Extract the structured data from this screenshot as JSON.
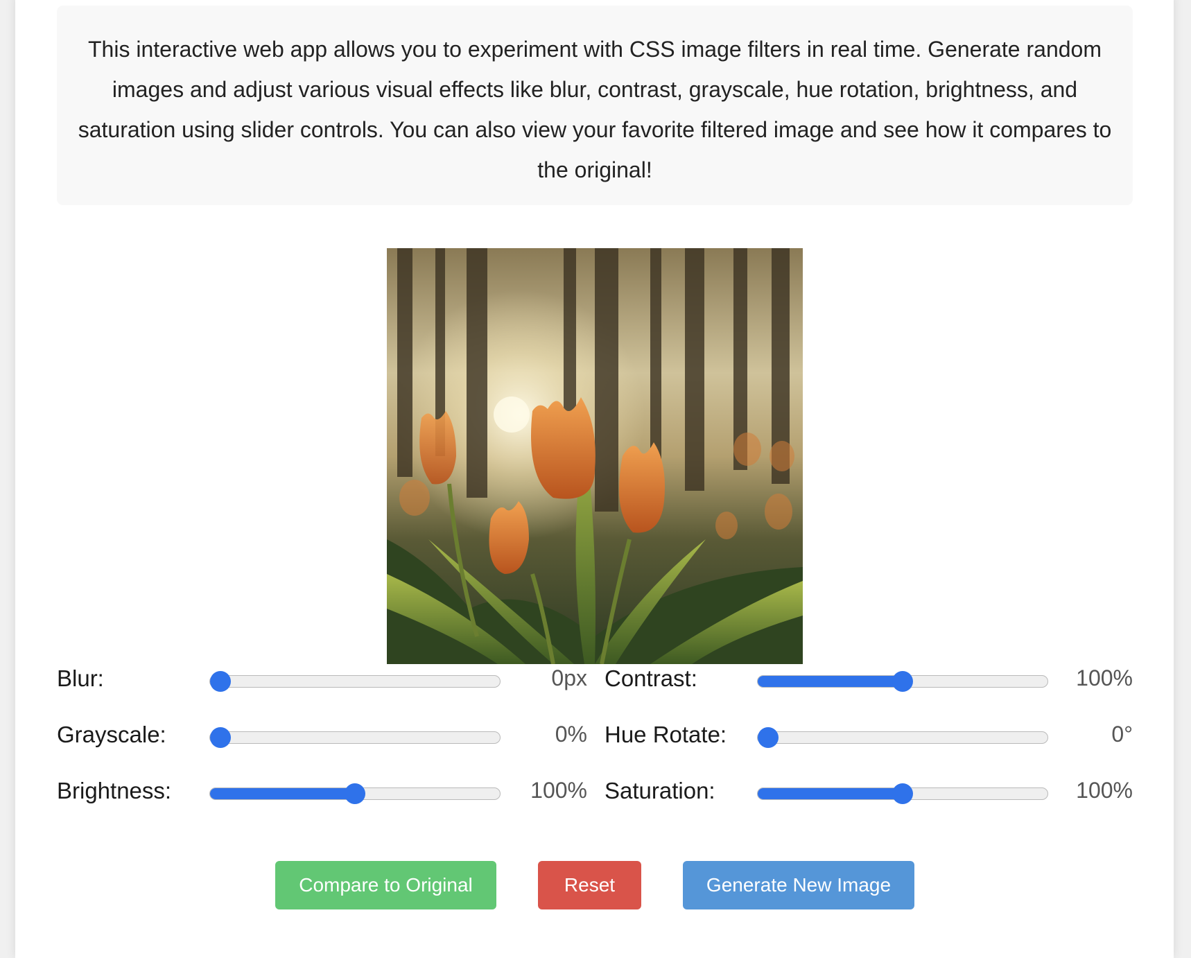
{
  "description": "This interactive web app allows you to experiment with CSS image filters in real time. Generate random images and adjust various visual effects like blur, contrast, grayscale, hue rotation, brightness, and saturation using slider controls. You can also view your favorite filtered image and see how it compares to the original!",
  "image": {
    "subject": "orange tulips in a forest at sunset"
  },
  "controls": {
    "blur": {
      "label": "Blur:",
      "value_text": "0px",
      "level": 0.0
    },
    "contrast": {
      "label": "Contrast:",
      "value_text": "100%",
      "level": 0.5
    },
    "grayscale": {
      "label": "Grayscale:",
      "value_text": "0%",
      "level": 0.0
    },
    "hue_rotate": {
      "label": "Hue Rotate:",
      "value_text": "0°",
      "level": 0.0
    },
    "brightness": {
      "label": "Brightness:",
      "value_text": "100%",
      "level": 0.5
    },
    "saturation": {
      "label": "Saturation:",
      "value_text": "100%",
      "level": 0.5
    }
  },
  "buttons": {
    "compare": "Compare to Original",
    "reset": "Reset",
    "generate": "Generate New Image"
  },
  "colors": {
    "slider_accent": "#2f72ea",
    "compare_button": "#62c774",
    "reset_button": "#d9544a",
    "generate_button": "#5596d8"
  }
}
